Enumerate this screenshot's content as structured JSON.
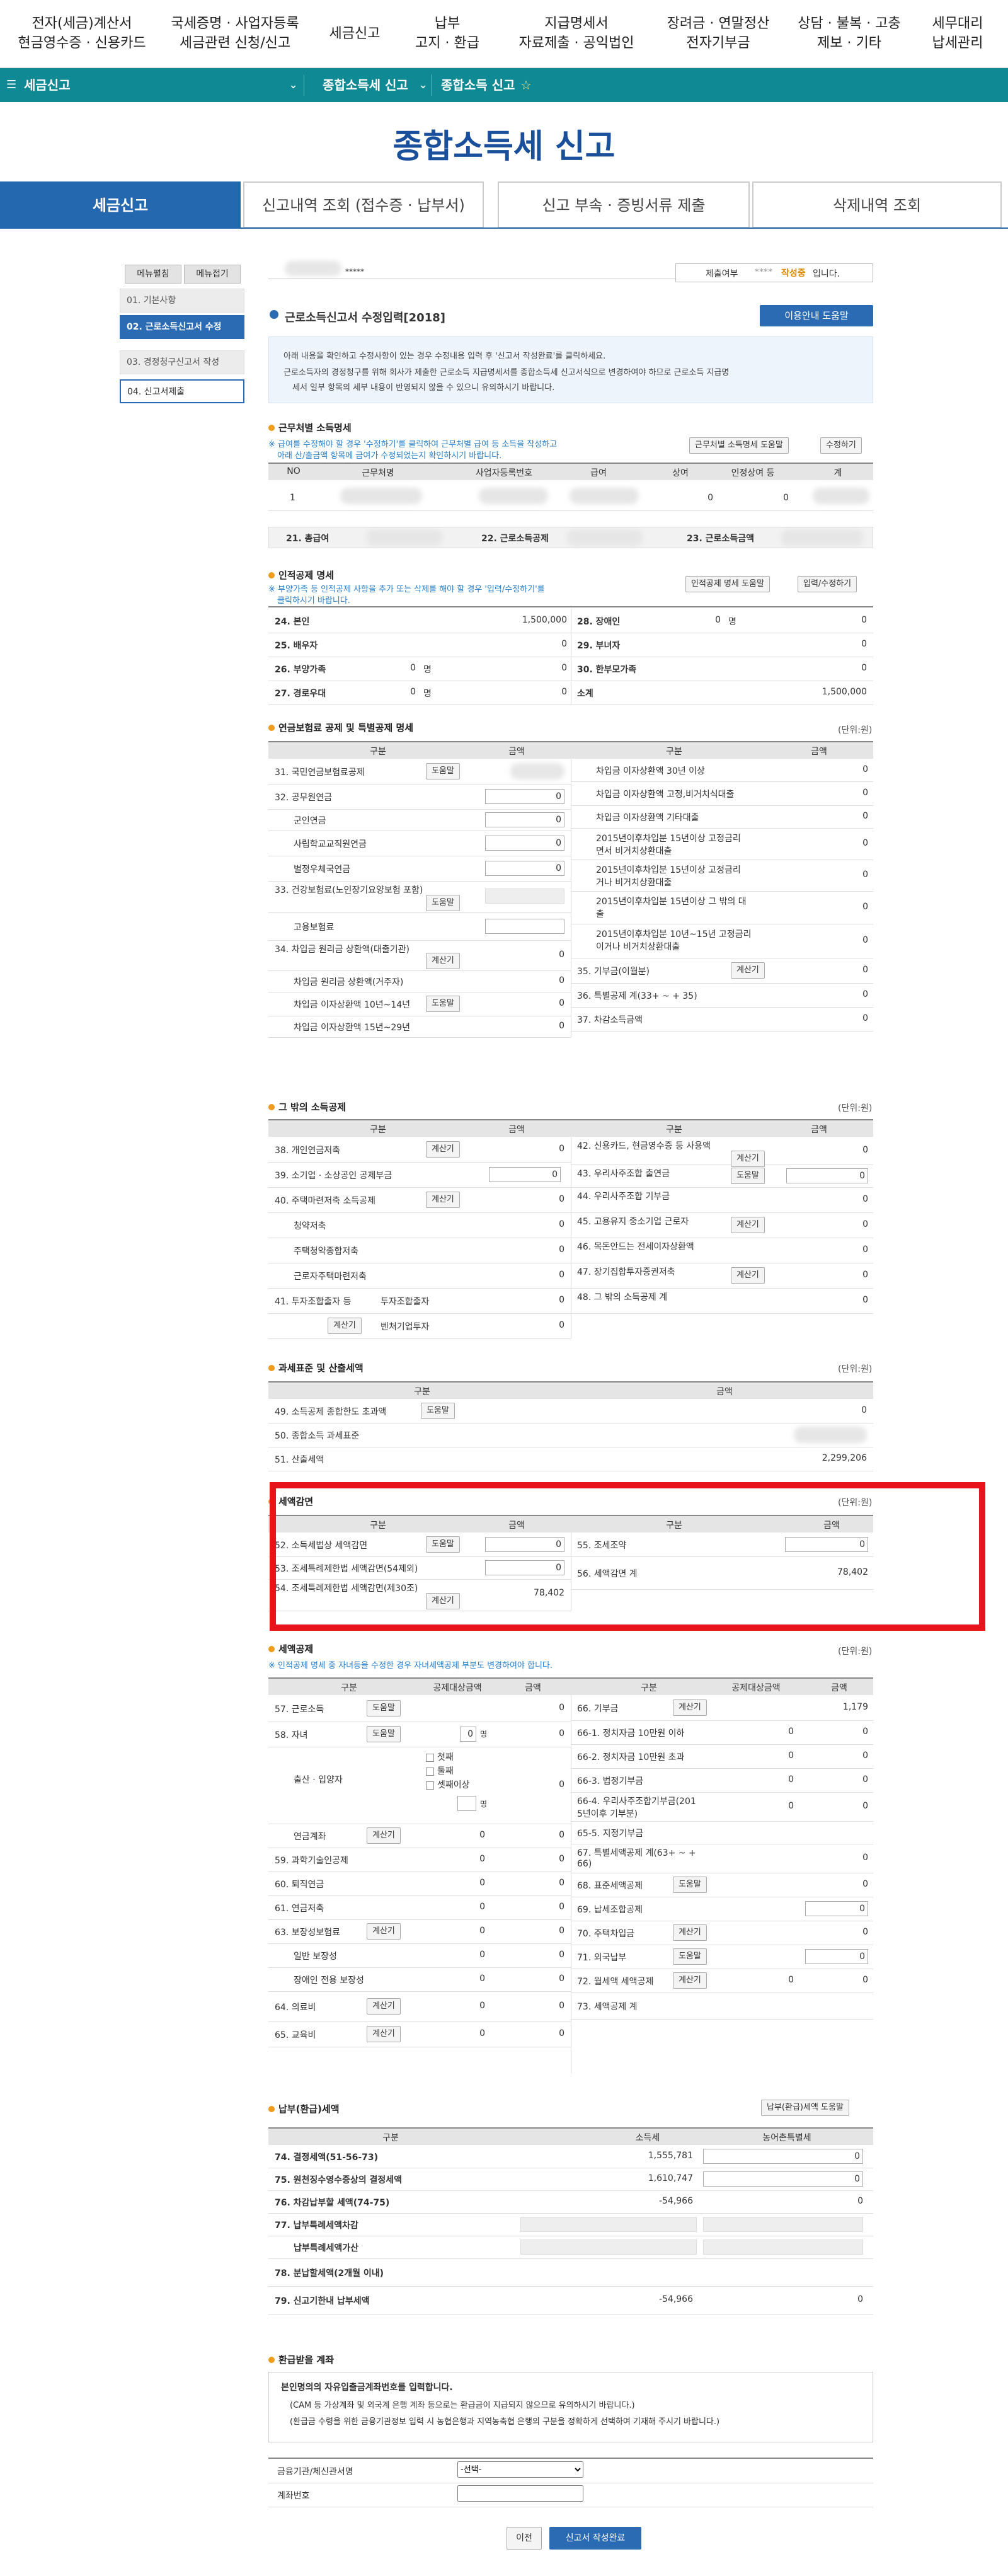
{
  "topnav": [
    {
      "label": "전자(세금)계산서\n현금영수증 · 신용카드"
    },
    {
      "label": "국세증명 · 사업자등록\n세금관련 신청/신고"
    },
    {
      "label": "세금신고"
    },
    {
      "label": "납부\n고지 · 환급"
    },
    {
      "label": "지급명세서\n자료제출 · 공익법인"
    },
    {
      "label": "장려금 · 연말정산\n전자기부금"
    },
    {
      "label": "상담 · 불복 · 고충\n제보 · 기타"
    },
    {
      "label": "세무대리\n납세관리"
    }
  ],
  "breadcrumb": {
    "home": "세금신고",
    "level2": "종합소득세 신고",
    "level3": "종합소득 신고",
    "star": "☆"
  },
  "page_title": "종합소득세 신고",
  "main_tabs": [
    {
      "label": "세금신고"
    },
    {
      "label": "신고내역 조회 (접수증 · 납부서)"
    },
    {
      "label": "신고 부속 · 증빙서류 제출"
    },
    {
      "label": "삭제내역 조회"
    }
  ],
  "side": {
    "btn_expand": "메뉴펼침",
    "btn_collapse": "메뉴접기",
    "items": [
      {
        "label": "01. 기본사항"
      },
      {
        "label": "02. 근로소득신고서 수정"
      },
      {
        "label": "03. 경정청구신고서 작성"
      },
      {
        "label": "04. 신고서제출"
      }
    ]
  },
  "userbar": {
    "name_suffix": "*****",
    "status_label": "제출여부",
    "status_mask": "****",
    "status_value": "작성중",
    "status_tail": "입니다."
  },
  "form_title": "근로소득신고서 수정입력[2018]",
  "help_button": "이용안내 도움말",
  "notice": [
    "아래 내용을 확인하고 수정사항이 있는 경우 수정내용 입력 후 '신고서 작성완료'를 클릭하세요.",
    "근로소득자의 경정청구를 위해 회사가 제출한 근로소득 지급명세서를 종합소득세 신고서식으로 변경하여야 하므로 근로소득 지급명",
    "세서 일부 항목의 세부 내용이 반영되지 않을 수 있으니 유의하시기 바랍니다."
  ],
  "income": {
    "title": "근무처별 소득명세",
    "note1": "※ 급여를 수정해야 할 경우 '수정하기'를 클릭하여 근무처별 급여 등 소득을 작성하고",
    "note2": "아래 산/출금액 항목에 금여가 수정되었는지 확인하시기 바랍니다.",
    "btn_help": "근무처별 소득명세 도움말",
    "btn_edit": "수정하기",
    "headers": [
      "NO",
      "근무처명",
      "사업자등록번호",
      "급여",
      "상여",
      "인정상여 등",
      "계"
    ],
    "row": {
      "no": "1",
      "v1": "0",
      "v2": "0"
    },
    "sum": [
      {
        "label": "21. 총급여"
      },
      {
        "label": "22. 근로소득공제"
      },
      {
        "label": "23. 근로소득금액"
      }
    ]
  },
  "personal": {
    "title": "인적공제 명세",
    "note1": "※ 부양가족 등 인적공제 사항을 추가 또는 삭제를 해야 할 경우 '입력/수정하기'를",
    "note2": "클릭하시기 바랍니다.",
    "btn_help": "인적공제 명세 도움말",
    "btn_edit": "입력/수정하기",
    "left": [
      {
        "label": "24. 본인",
        "value": "1,500,000"
      },
      {
        "label": "25. 배우자",
        "value": "0"
      },
      {
        "label": "26. 부양가족",
        "count": "0",
        "unit": "명",
        "value": "0"
      },
      {
        "label": "27. 경로우대",
        "count": "0",
        "unit": "명",
        "value": "0"
      }
    ],
    "right": [
      {
        "label": "28. 장애인",
        "count": "0",
        "unit": "명",
        "value": "0"
      },
      {
        "label": "29. 부녀자",
        "value": "0"
      },
      {
        "label": "30. 한부모가족",
        "value": "0"
      },
      {
        "label": "소계",
        "value": "1,500,000"
      }
    ]
  },
  "pension": {
    "title": "연금보험료 공제 및 특별공제 명세",
    "unit": "(단위:원)",
    "h_cat": "구분",
    "h_amt": "금액",
    "left": [
      {
        "label": "31. 국민연금보험료공제",
        "btn": "도움말"
      },
      {
        "label": "32. 공무원연금",
        "value": "0"
      },
      {
        "label": "군인연금",
        "value": "0"
      },
      {
        "label": "사립학교교직원연금",
        "value": "0"
      },
      {
        "label": "별정우체국연금",
        "value": "0"
      },
      {
        "label": "33. 건강보험료(노인장기요양보험 포함)",
        "btn": "도움말"
      },
      {
        "label": "고용보험료"
      },
      {
        "label": "34. 차입금 원리금 상환액(대출기관)",
        "btn": "계산기",
        "value": "0"
      },
      {
        "label": "차입금 원리금 상환액(거주자)",
        "value": "0"
      },
      {
        "label": "차입금 이자상환액 10년~14년",
        "btn": "도움말",
        "value": "0"
      },
      {
        "label": "차입금 이자상환액 15년~29년",
        "value": "0"
      }
    ],
    "right": [
      {
        "label": "차입금 이자상환액 30년 이상",
        "value": "0"
      },
      {
        "label": "차입금 이자상환액 고정,비거치식대출",
        "value": "0"
      },
      {
        "label": "차입금 이자상환액 기타대출",
        "value": "0"
      },
      {
        "label": "2015년이후차입분 15년이상 고정금리",
        "label2": "면서 비거치상환대출",
        "value": "0"
      },
      {
        "label": "2015년이후차입분 15년이상 고정금리",
        "label2": "거나 비거치상환대출",
        "value": "0"
      },
      {
        "label": "2015년이후차입분 15년이상 그 밖의 대",
        "label2": "출",
        "value": "0"
      },
      {
        "label": "2015년이후차입분 10년~15년 고정금리",
        "label2": "이거나 비거치상환대출",
        "value": "0"
      },
      {
        "label": "35. 기부금(이월분)",
        "btn": "계산기",
        "value": "0"
      },
      {
        "label": "36. 특별공제 계(33+ ~ + 35)",
        "value": "0"
      },
      {
        "label": "37. 차감소득금액",
        "value": "0"
      }
    ]
  },
  "other": {
    "title": "그 밖의 소득공제",
    "unit": "(단위:원)",
    "h_cat": "구분",
    "h_amt": "금액",
    "left": [
      {
        "label": "38. 개인연금저축",
        "btn": "계산기",
        "value": "0"
      },
      {
        "label": "39. 소기업 · 소상공인 공제부금",
        "value": "0"
      },
      {
        "label": "40. 주택마련저축 소득공제",
        "btn": "계산기",
        "value": "0"
      },
      {
        "label": "청약저축",
        "value": "0"
      },
      {
        "label": "주택청약종합저축",
        "value": "0"
      },
      {
        "label": "근로자주택마련저축",
        "value": "0"
      },
      {
        "label": "41. 투자조합출자 등",
        "sub": "투자조합출자",
        "value": "0"
      },
      {
        "btn": "계산기",
        "sub": "벤처기업투자",
        "value": "0"
      }
    ],
    "right": [
      {
        "label": "42. 신용카드, 현금영수증 등 사용액",
        "btn": "계산기",
        "value": "0"
      },
      {
        "label": "43. 우리사주조합 출연금",
        "btn": "도움말",
        "value": "0"
      },
      {
        "label": "44. 우리사주조합 기부금",
        "value": "0"
      },
      {
        "label": "45. 고용유지 중소기업 근로자",
        "btn": "계산기",
        "value": "0"
      },
      {
        "label": "46. 목돈안드는 전세이자상환액",
        "value": "0"
      },
      {
        "label": "47. 장기집합투자증권저축",
        "btn": "계산기",
        "value": "0"
      },
      {
        "label": "48. 그 밖의 소득공제 계",
        "value": "0"
      }
    ]
  },
  "taxbase": {
    "title": "과세표준 및 산출세액",
    "unit": "(단위:원)",
    "h_cat": "구분",
    "h_amt": "금액",
    "rows": [
      {
        "label": "49. 소득공제 종합한도 초과액",
        "btn": "도움말",
        "value": "0"
      },
      {
        "label": "50. 종합소득 과세표준",
        "value": ""
      },
      {
        "label": "51. 산출세액",
        "value": "2,299,206"
      }
    ]
  },
  "reduction": {
    "title": "세액감면",
    "unit": "(단위:원)",
    "h_cat": "구분",
    "h_amt": "금액",
    "left": [
      {
        "label": "52. 소득세법상 세액감면",
        "btn": "도움말",
        "value": "0"
      },
      {
        "label": "53. 조세특례제한법 세액감면(54제외)",
        "value": "0"
      },
      {
        "label": "54. 조세특례제한법 세액감면(제30조)",
        "btn": "계산기",
        "value": "78,402"
      }
    ],
    "right": [
      {
        "label": "55. 조세조약",
        "value": "0"
      },
      {
        "label": "56. 세액감면 계",
        "value": "78,402"
      }
    ]
  },
  "credit": {
    "title": "세액공제",
    "unit": "(단위:원)",
    "note": "※ 인적공제 명세 중 자녀등을 수정한 경우 자녀세액공제 부분도 변경하여야 합니다.",
    "h_cat": "구분",
    "h_base": "공제대상금액",
    "h_amt": "금액",
    "left": [
      {
        "label": "57. 근로소득",
        "btn": "도움말",
        "value": "0"
      },
      {
        "label": "58. 자녀",
        "btn": "도움말",
        "count": "0",
        "unit": "명",
        "value": "0"
      },
      {
        "label": "출산 · 입양자",
        "value": "0"
      },
      {
        "label": "연금계좌",
        "btn": "계산기",
        "base": "0",
        "value": "0"
      },
      {
        "label": "59. 과학기술인공제",
        "base": "0",
        "value": "0"
      },
      {
        "label": "60. 퇴직연금",
        "base": "0",
        "value": "0"
      },
      {
        "label": "61. 연금저축",
        "base": "0",
        "value": "0"
      },
      {
        "label": "63. 보장성보험료",
        "btn": "계산기",
        "base": "0",
        "value": "0"
      },
      {
        "label": "일반 보장성",
        "base": "0",
        "value": "0"
      },
      {
        "label": "장애인 전용 보장성",
        "base": "0",
        "value": "0"
      },
      {
        "label": "64. 의료비",
        "btn": "계산기",
        "base": "0",
        "value": "0"
      },
      {
        "label": "65. 교육비",
        "btn": "계산기",
        "base": "0",
        "value": "0"
      }
    ],
    "birth_checks": [
      "첫째",
      "둘째",
      "셋째이상"
    ],
    "birth_unit": "명",
    "right": [
      {
        "label": "66. 기부금",
        "btn": "계산기",
        "value": "1,179"
      },
      {
        "label": "66-1. 정치자금 10만원 이하",
        "base": "0",
        "value": "0"
      },
      {
        "label": "66-2. 정치자금 10만원 초과",
        "base": "0",
        "value": "0"
      },
      {
        "label": "66-3. 법정기부금",
        "base": "0",
        "value": "0"
      },
      {
        "label": "66-4. 우리사주조합기부금(201",
        "label2": "5년이후 기부분)",
        "base": "0",
        "value": "0"
      },
      {
        "label": "65-5. 지정기부금",
        "value": ""
      },
      {
        "label": "67. 특별세액공제 계(63+ ~ +",
        "label2": "66)",
        "value": "0"
      },
      {
        "label": "68. 표준세액공제",
        "btn": "도움말",
        "value": "0"
      },
      {
        "label": "69. 납세조합공제",
        "value": "0"
      },
      {
        "label": "70. 주택차입금",
        "btn": "계산기",
        "value": "0"
      },
      {
        "label": "71. 외국납부",
        "btn": "도움말",
        "value": "0"
      },
      {
        "label": "72. 월세액 세액공제",
        "btn": "계산기",
        "base": "0",
        "value": "0"
      },
      {
        "label": "73. 세액공제 계",
        "value": ""
      }
    ]
  },
  "payment": {
    "title": "납부(환급)세액",
    "btn_help": "납부(환급)세액 도움말",
    "h_cat": "구분",
    "h_income": "소득세",
    "h_farm": "농어촌특별세",
    "rows": [
      {
        "label": "74. 결정세액(51-56-73)",
        "income": "1,555,781",
        "farm": "0"
      },
      {
        "label": "75. 원천징수영수증상의 결정세액",
        "income": "1,610,747",
        "farm": "0"
      },
      {
        "label": "76. 차감납부할 세액(74-75)",
        "income": "-54,966",
        "farm": "0"
      },
      {
        "label": "77. 납부특례세액차감",
        "income": "",
        "farm": ""
      },
      {
        "label": "납부특례세액가산",
        "income": "",
        "farm": ""
      },
      {
        "label": "78. 분납할세액(2개월 이내)",
        "income": "",
        "farm": ""
      },
      {
        "label": "79. 신고기한내 납부세액",
        "income": "-54,966",
        "farm": "0"
      }
    ]
  },
  "refund": {
    "title": "환급받을 계좌",
    "head": "본인명의의 자유입출금계좌번호를 입력합니다.",
    "line1": "(CAM 등 가상계좌 및 외국계 은행 계좌 등으로는 환급금이 지급되지 않으므로 유의하시기 바랍니다.)",
    "line2": "(환급금 수령을 위한 금융기관정보 입력 시 농협은행과 지역농축협 은행의 구분을 정확하게 선택하여 기재해 주시기 바랍니다.)",
    "bank_label": "금융기관/체신관서명",
    "bank_select": "-선택-",
    "account_label": "계좌번호"
  },
  "footer": {
    "prev": "이전",
    "complete": "신고서 작성완료"
  }
}
